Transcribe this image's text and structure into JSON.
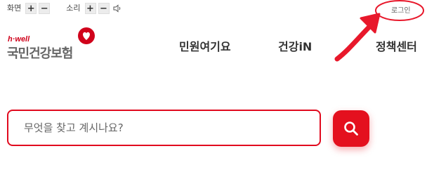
{
  "utility": {
    "screen_label": "화면",
    "sound_label": "소리",
    "plus": "+",
    "minus": "−"
  },
  "header": {
    "login_label": "로그인",
    "logo": {
      "small_text": "h·well",
      "main_text": "국민건강보험"
    },
    "nav": [
      {
        "label": "민원여기요"
      },
      {
        "label": "건강iN"
      },
      {
        "label": "정책센터"
      }
    ]
  },
  "search": {
    "placeholder": "무엇을 찾고 계시나요?",
    "value": ""
  },
  "colors": {
    "brand_red": "#e4101e",
    "annotation_red": "#e8182b",
    "text_gray": "#333333"
  },
  "icons": [
    "speaker-icon",
    "heart-icon",
    "search-icon",
    "annotation-arrow",
    "annotation-circle"
  ]
}
